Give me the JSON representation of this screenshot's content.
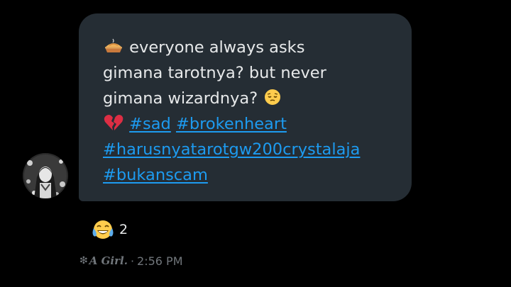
{
  "message": {
    "lines": [
      {
        "icon": "pie-icon",
        "text": "everyone always asks"
      },
      {
        "text": "gimana tarotnya? but never"
      },
      {
        "text": "gimana wizardnya?",
        "icon_after": "pensive-face-icon"
      }
    ],
    "hashtag_icon": "broken-heart-icon",
    "hashtags": [
      "#sad",
      "#brokenheart",
      "#harusnyatarotgw200crystalaja",
      "#bukanscam"
    ]
  },
  "reaction": {
    "icon": "tears-of-joy-icon",
    "count": "2"
  },
  "meta": {
    "sender_prefix": "❇",
    "sender_name": "A Girl.",
    "separator": "·",
    "time": "2:56 PM"
  },
  "colors": {
    "background": "#000000",
    "bubble": "#252d34",
    "text": "#e7e9ea",
    "link": "#1d9bf0",
    "meta": "#71767b"
  }
}
